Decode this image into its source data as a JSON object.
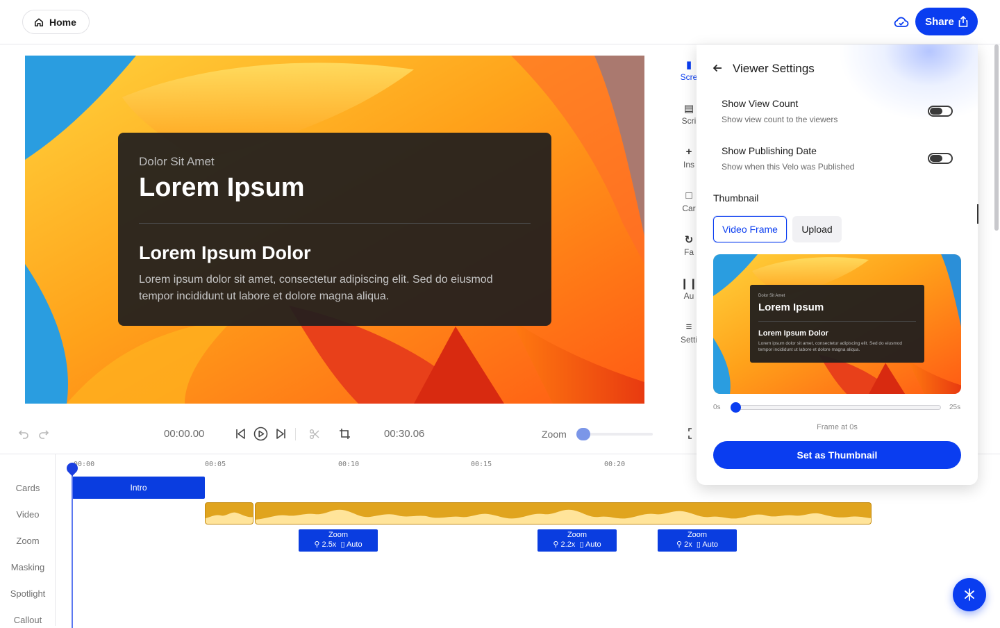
{
  "topbar": {
    "home_label": "Home",
    "home_icon": "home-icon",
    "cloud_icon": "cloud-check-icon",
    "share_label": "Share",
    "share_icon": "share-upload-icon"
  },
  "preview_card": {
    "eyebrow": "Dolor Sit Amet",
    "title": "Lorem Ipsum",
    "subtitle": "Lorem Ipsum Dolor",
    "body": "Lorem ipsum dolor sit amet, consectetur adipiscing elit. Sed do eiusmod tempor incididunt ut labore et dolore magna aliqua."
  },
  "rail": {
    "items": [
      {
        "label": "Scre",
        "icon": "screen-icon",
        "active": true
      },
      {
        "label": "Scri",
        "icon": "script-icon",
        "active": false
      },
      {
        "label": "Ins",
        "icon": "plus-icon",
        "active": false
      },
      {
        "label": "Car",
        "icon": "card-icon",
        "active": false
      },
      {
        "label": "Fa",
        "icon": "face-icon",
        "active": false
      },
      {
        "label": "Au",
        "icon": "audio-icon",
        "active": false
      },
      {
        "label": "Setti",
        "icon": "settings-icon",
        "active": false
      }
    ]
  },
  "controls": {
    "current_time": "00:00.00",
    "total_time": "00:30.06",
    "zoom_label": "Zoom"
  },
  "timeline": {
    "tracks": [
      "Cards",
      "Video",
      "Zoom",
      "Masking",
      "Spotlight",
      "Callout"
    ],
    "ruler": [
      "00:00",
      "00:05",
      "00:10",
      "00:15",
      "00:20"
    ],
    "intro_label": "Intro",
    "zoom_clips": [
      {
        "title": "Zoom",
        "factor": "2.5x",
        "mode": "Auto"
      },
      {
        "title": "Zoom",
        "factor": "2.2x",
        "mode": "Auto"
      },
      {
        "title": "Zoom",
        "factor": "2x",
        "mode": "Auto"
      }
    ]
  },
  "viewer_settings": {
    "title": "Viewer Settings",
    "show_view_count": {
      "title": "Show View Count",
      "subtitle": "Show view count to the viewers",
      "enabled": false
    },
    "show_publishing_date": {
      "title": "Show Publishing Date",
      "subtitle": "Show when this Velo was Published",
      "enabled": false
    },
    "thumbnail_label": "Thumbnail",
    "tabs": {
      "video_frame": "Video Frame",
      "upload": "Upload"
    },
    "thumb_card": {
      "eyebrow": "Dolor Sit Amet",
      "title": "Lorem Ipsum",
      "subtitle": "Lorem Ipsum Dolor",
      "body": "Lorem ipsum dolor sit amet, consectetur adipiscing elit. Sed do eiusmod tempor incididunt ut labore et dolore magna aliqua."
    },
    "slider_min": "0s",
    "slider_max": "25s",
    "slider_value_fraction": 0,
    "frame_at": "Frame at 0s",
    "set_button": "Set as Thumbnail"
  },
  "colors": {
    "accent": "#0a3df0",
    "video_track": "#e0a41e",
    "card_bg": "#201e1e"
  }
}
